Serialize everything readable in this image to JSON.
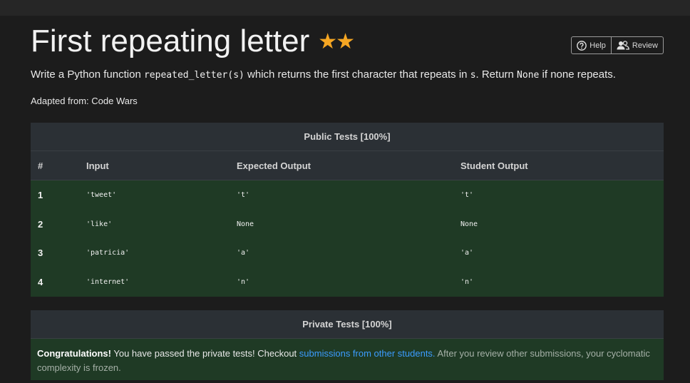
{
  "page": {
    "title": "First repeating letter",
    "stars": "★★",
    "help_label": "Help",
    "review_label": "Review",
    "description": {
      "pre": "Write a Python function ",
      "func": "repeated_letter(s)",
      "mid": " which returns the first character that repeats in ",
      "arg": "s",
      "mid2": ". Return ",
      "none": "None",
      "post": " if none repeats."
    },
    "adapted": "Adapted from: Code Wars"
  },
  "public_tests": {
    "heading": "Public Tests [100%]",
    "columns": [
      "#",
      "Input",
      "Expected Output",
      "Student Output"
    ],
    "rows": [
      {
        "num": "1",
        "input": "'tweet'",
        "expected": "'t'",
        "student": "'t'"
      },
      {
        "num": "2",
        "input": "'like'",
        "expected": "None",
        "student": "None"
      },
      {
        "num": "3",
        "input": "'patricia'",
        "expected": "'a'",
        "student": "'a'"
      },
      {
        "num": "4",
        "input": "'internet'",
        "expected": "'n'",
        "student": "'n'"
      }
    ]
  },
  "private_tests": {
    "heading": "Private Tests [100%]",
    "congrats": "Congratulations!",
    "text1": " You have passed the private tests! Checkout ",
    "link": "submissions from other students.",
    "text2": " After you review other submissions, your cyclomatic complexity is frozen."
  },
  "colors": {
    "background": "#1c1c1c",
    "star": "#f5a623",
    "pass_row": "#1f3a25",
    "link": "#3b9cff"
  },
  "icons": [
    "question-circle-icon",
    "users-icon"
  ]
}
